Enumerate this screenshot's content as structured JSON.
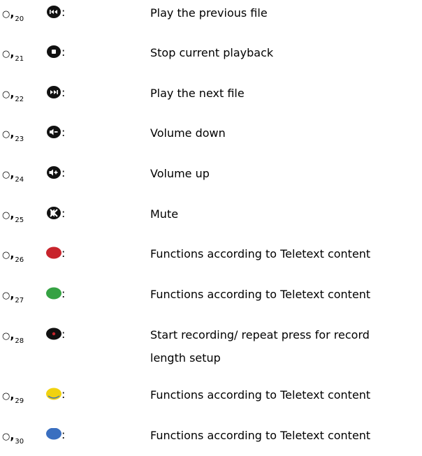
{
  "items": [
    {
      "bullet": "○",
      "number": "20",
      "icon": "previous-file-icon",
      "colon": ":",
      "description": [
        "Play the previous file"
      ]
    },
    {
      "bullet": "○",
      "number": "21",
      "icon": "stop-icon",
      "colon": ":",
      "description": [
        "Stop current playback"
      ]
    },
    {
      "bullet": "○",
      "number": "22",
      "icon": "next-file-icon",
      "colon": ":",
      "description": [
        "Play the next file"
      ]
    },
    {
      "bullet": "○",
      "number": "23",
      "icon": "volume-down-icon",
      "colon": ":",
      "description": [
        "Volume down"
      ]
    },
    {
      "bullet": "○",
      "number": "24",
      "icon": "volume-up-icon",
      "colon": ":",
      "description": [
        "Volume up"
      ]
    },
    {
      "bullet": "○",
      "number": "25",
      "icon": "mute-icon",
      "colon": ":",
      "description": [
        "Mute"
      ]
    },
    {
      "bullet": "○",
      "number": "26",
      "icon": "red-button-icon",
      "colon": ":",
      "description": [
        "Functions according to Teletext content"
      ]
    },
    {
      "bullet": "○",
      "number": "27",
      "icon": "green-button-icon",
      "colon": ":",
      "description": [
        "Functions according to Teletext content"
      ]
    },
    {
      "bullet": "○",
      "number": "28",
      "icon": "record-button-icon",
      "colon": ":",
      "description": [
        "Start recording/ repeat press for record",
        "length setup"
      ]
    },
    {
      "bullet": "○",
      "number": "29",
      "icon": "yellow-button-icon",
      "colon": ":",
      "description": [
        "Functions according to Teletext content"
      ]
    },
    {
      "bullet": "○",
      "number": "30",
      "icon": "blue-button-icon",
      "colon": ":",
      "description": [
        "Functions according to Teletext content"
      ]
    }
  ],
  "colors": {
    "red": "#c8242c",
    "green": "#35a243",
    "yellow": "#f1d20f",
    "blue": "#3a6fc0",
    "black": "#111111"
  }
}
